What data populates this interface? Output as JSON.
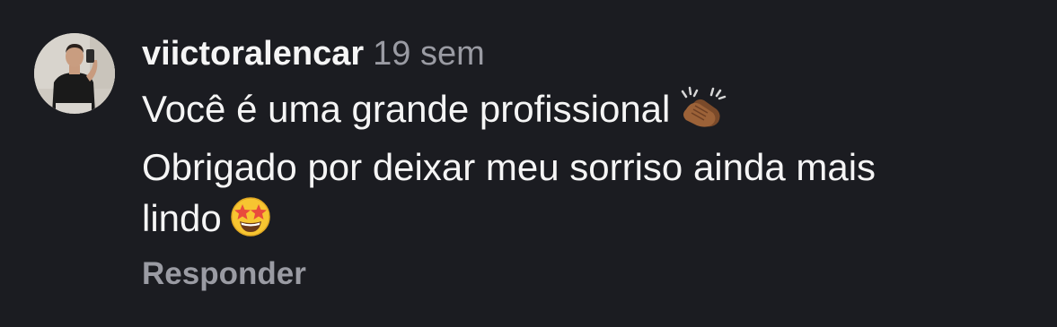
{
  "comment": {
    "username": "viictoralencar",
    "timestamp": "19 sem",
    "line1": "Você é uma grande profissional",
    "line1_emoji": "clapping-hands-icon",
    "line2": "Obrigado por deixar meu sorriso ainda mais",
    "line3": "lindo",
    "line3_emoji": "star-struck-icon",
    "reply_label": "Responder"
  },
  "colors": {
    "background": "#1b1c21",
    "text": "#f5f5f5",
    "muted": "#9a9ba3"
  }
}
